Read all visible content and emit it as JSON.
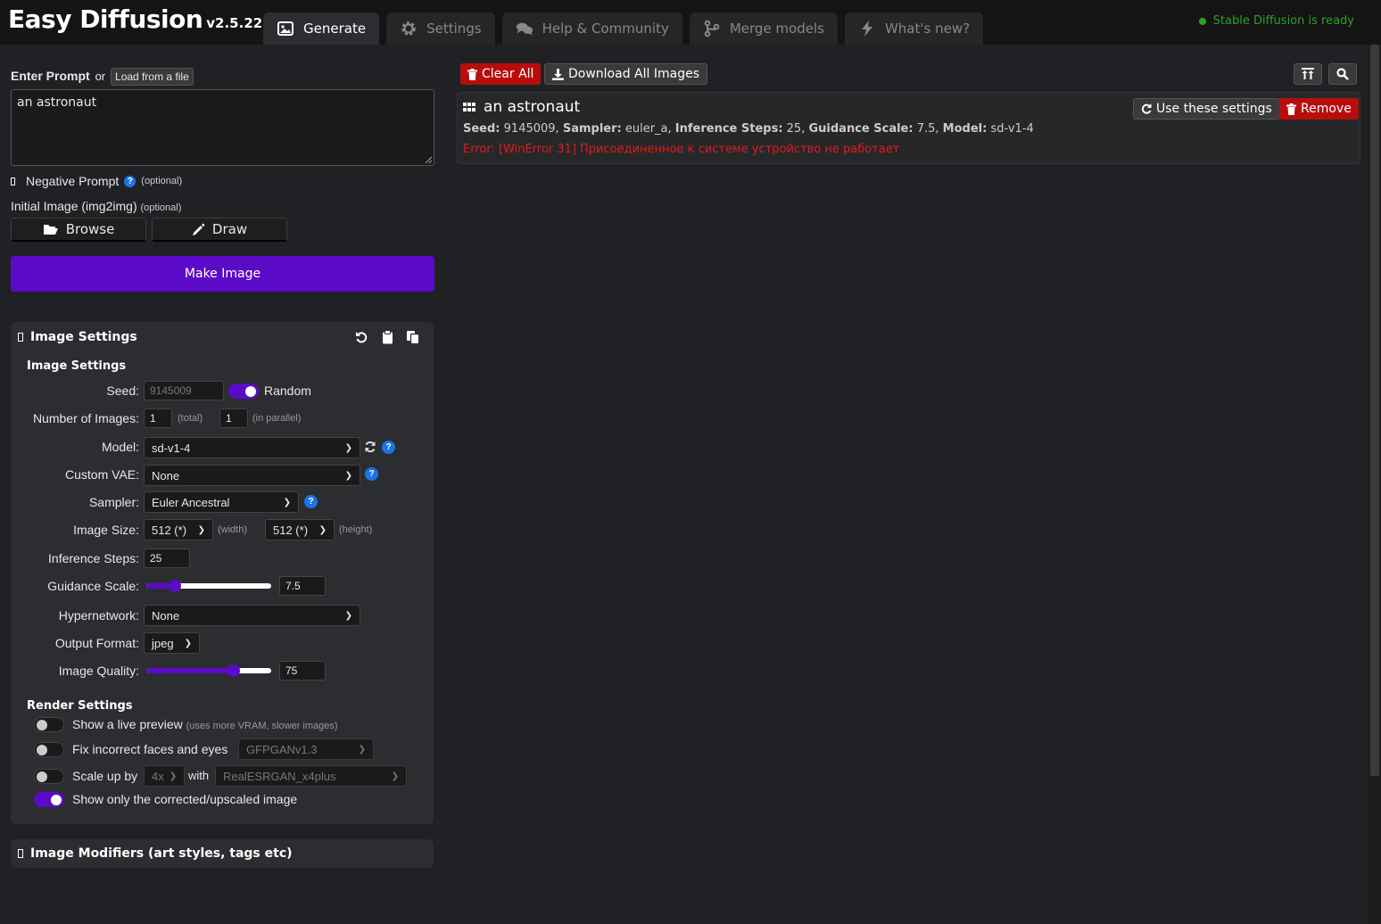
{
  "header": {
    "app_name": "Easy Diffusion",
    "version": "v2.5.22",
    "status": "Stable Diffusion is ready",
    "status_color": "#2aa22a",
    "tabs": [
      {
        "label": "Generate",
        "icon": "image-icon",
        "active": true
      },
      {
        "label": "Settings",
        "icon": "gear-icon",
        "active": false
      },
      {
        "label": "Help & Community",
        "icon": "comments-icon",
        "active": false
      },
      {
        "label": "Merge models",
        "icon": "branch-icon",
        "active": false
      },
      {
        "label": "What's new?",
        "icon": "bolt-icon",
        "active": false
      }
    ]
  },
  "prompt": {
    "label": "Enter Prompt",
    "or": "or",
    "load_file": "Load from a file",
    "value": "an astronaut",
    "negative_label": "Negative Prompt",
    "optional": "(optional)",
    "initial_image_label": "Initial Image (img2img)",
    "browse": "Browse",
    "draw": "Draw",
    "make_image": "Make Image",
    "accent_color": "#5b0bc7"
  },
  "image_settings": {
    "panel_title": "Image Settings",
    "sub_title": "Image Settings",
    "seed_label": "Seed:",
    "seed_value": "9145009",
    "random_label": "Random",
    "random_on": true,
    "num_images_label": "Number of Images:",
    "num_total": "1",
    "total_hint": "(total)",
    "num_parallel": "1",
    "parallel_hint": "(in parallel)",
    "model_label": "Model:",
    "model_value": "sd-v1-4",
    "vae_label": "Custom VAE:",
    "vae_value": "None",
    "sampler_label": "Sampler:",
    "sampler_value": "Euler Ancestral",
    "size_label": "Image Size:",
    "width_value": "512 (*)",
    "width_hint": "(width)",
    "height_value": "512 (*)",
    "height_hint": "(height)",
    "steps_label": "Inference Steps:",
    "steps_value": "25",
    "guidance_label": "Guidance Scale:",
    "guidance_value": "7.5",
    "guidance_fraction": 0.2,
    "hypernetwork_label": "Hypernetwork:",
    "hypernetwork_value": "None",
    "format_label": "Output Format:",
    "format_value": "jpeg",
    "quality_label": "Image Quality:",
    "quality_value": "75",
    "quality_fraction": 0.72
  },
  "render_settings": {
    "title": "Render Settings",
    "live_preview_label": "Show a live preview",
    "live_preview_hint": "(uses more VRAM, slower images)",
    "live_preview_on": false,
    "fix_faces_label": "Fix incorrect faces and eyes",
    "fix_faces_model": "GFPGANv1.3",
    "fix_faces_on": false,
    "scale_label": "Scale up by",
    "scale_value": "4x",
    "with_label": "with",
    "upscaler": "RealESRGAN_x4plus",
    "scale_on": false,
    "corrected_only_label": "Show only the corrected/upscaled image",
    "corrected_only_on": true
  },
  "modifiers": {
    "title": "Image Modifiers (art styles, tags etc)"
  },
  "results": {
    "clear_all": "Clear All",
    "download_all": "Download All Images",
    "task": {
      "prompt": "an astronaut",
      "seed_key": "Seed:",
      "seed": "9145009,",
      "sampler_key": "Sampler:",
      "sampler": "euler_a,",
      "steps_key": "Inference Steps:",
      "steps": "25,",
      "guidance_key": "Guidance Scale:",
      "guidance": "7.5,",
      "model_key": "Model:",
      "model": "sd-v1-4",
      "error": "Error: [WinError 31] Присоединенное к системе устройство не работает",
      "use_settings": "Use these settings",
      "remove": "Remove"
    }
  }
}
